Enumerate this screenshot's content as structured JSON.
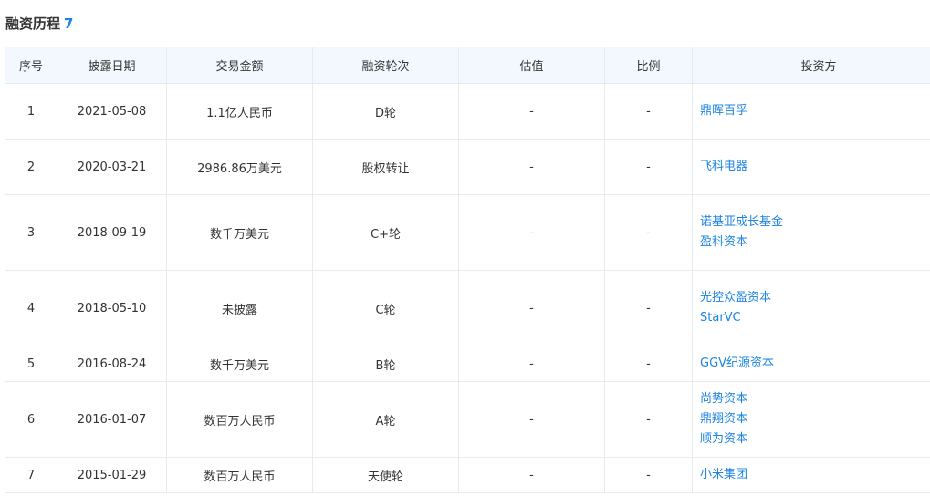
{
  "section": {
    "title": "融资历程",
    "count": "7"
  },
  "headers": [
    "序号",
    "披露日期",
    "交易金额",
    "融资轮次",
    "估值",
    "比例",
    "投资方"
  ],
  "rows": [
    {
      "no": "1",
      "date": "2021-05-08",
      "amount": "1.1亿人民币",
      "round": "D轮",
      "valuation": "-",
      "ratio": "-",
      "investors": [
        "鼎晖百孚"
      ]
    },
    {
      "no": "2",
      "date": "2020-03-21",
      "amount": "2986.86万美元",
      "round": "股权转让",
      "valuation": "-",
      "ratio": "-",
      "investors": [
        "飞科电器"
      ]
    },
    {
      "no": "3",
      "date": "2018-09-19",
      "amount": "数千万美元",
      "round": "C+轮",
      "valuation": "-",
      "ratio": "-",
      "investors": [
        "诺基亚成长基金",
        "盈科资本"
      ]
    },
    {
      "no": "4",
      "date": "2018-05-10",
      "amount": "未披露",
      "round": "C轮",
      "valuation": "-",
      "ratio": "-",
      "investors": [
        "光控众盈资本",
        "StarVC"
      ]
    },
    {
      "no": "5",
      "date": "2016-08-24",
      "amount": "数千万美元",
      "round": "B轮",
      "valuation": "-",
      "ratio": "-",
      "investors": [
        "GGV纪源资本"
      ]
    },
    {
      "no": "6",
      "date": "2016-01-07",
      "amount": "数百万人民币",
      "round": "A轮",
      "valuation": "-",
      "ratio": "-",
      "investors": [
        "尚势资本",
        "鼎翔资本",
        "顺为资本"
      ]
    },
    {
      "no": "7",
      "date": "2015-01-29",
      "amount": "数百万人民币",
      "round": "天使轮",
      "valuation": "-",
      "ratio": "-",
      "investors": [
        "小米集团"
      ]
    }
  ],
  "colors": {
    "link": "#1c83e1",
    "header_bg": "#f2f8fd",
    "border": "#e6ebf0"
  }
}
